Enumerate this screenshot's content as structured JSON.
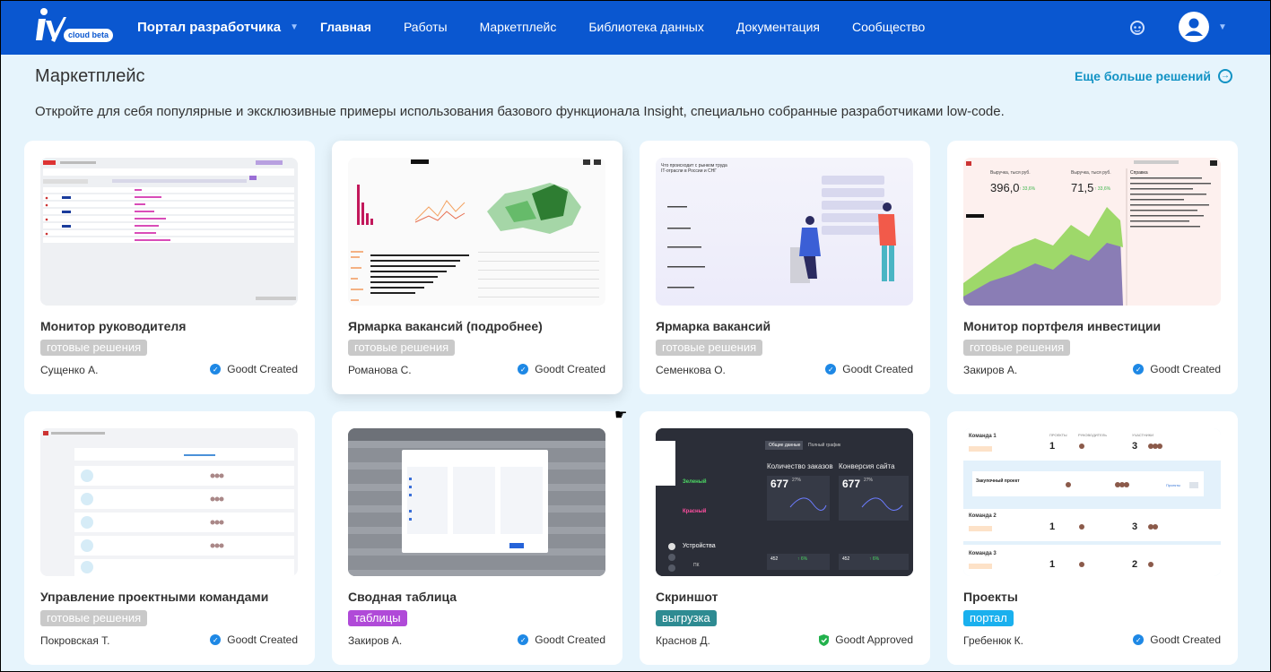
{
  "header": {
    "logo_badge": "cloud beta",
    "portal": "Портал разработчика",
    "nav": [
      "Главная",
      "Работы",
      "Маркетплейс",
      "Библиотека данных",
      "Документация",
      "Сообщество"
    ]
  },
  "page": {
    "title": "Маркетплейс",
    "more_link": "Еще больше решений",
    "subtitle": "Откройте для себя популярные и эксклюзивные примеры использования базового функционала Insight, специально собранные разработчиками low-code."
  },
  "colors": {
    "header": "#0a57d0",
    "tag_ready": "#c9c9c9",
    "tag_tables": "#b04ad8",
    "tag_export": "#2e8b92",
    "tag_portal": "#1ab0ee",
    "check_blue": "#1e88e5",
    "check_green": "#22b14c"
  },
  "cards": [
    {
      "title": "Монитор руководителя",
      "tag": "готовые решения",
      "author": "Сущенко А.",
      "badge": "Goodt Created"
    },
    {
      "title": "Ярмарка вакансий (подробнее)",
      "tag": "готовые решения",
      "author": "Романова С.",
      "badge": "Goodt Created"
    },
    {
      "title": "Ярмарка вакансий",
      "tag": "готовые решения",
      "author": "Семенкова О.",
      "badge": "Goodt Created",
      "thumb_text": [
        "Что происходит с рынком труда",
        "IT-отрасли в России и СНГ"
      ]
    },
    {
      "title": "Монитор портфеля инвестиции",
      "tag": "готовые решения",
      "author": "Закиров А.",
      "badge": "Goodt Created",
      "thumb_text": [
        "Выручка, тыся руб.",
        "396,0",
        "↑ 33,6%",
        "Выручка, тыся руб.",
        "71,5",
        "↑ 33,6%",
        "Справка"
      ]
    },
    {
      "title": "Управление проектными командами",
      "tag": "готовые решения",
      "author": "Покровская Т.",
      "badge": "Goodt Created"
    },
    {
      "title": "Сводная таблица",
      "tag": "таблицы",
      "author": "Закиров А.",
      "badge": "Goodt Created"
    },
    {
      "title": "Скриншот",
      "tag": "выгрузка",
      "author": "Краснов Д.",
      "badge": "Goodt Approved",
      "thumb_text": [
        "Общие данные",
        "Полный график",
        "Количество заказов",
        "Конверсия сайта",
        "677",
        "27%",
        "677",
        "27%",
        "Зеленый",
        "Красный",
        "Устройства",
        "ПК",
        "452",
        "↑ 6%",
        "452",
        "↑ 6%"
      ]
    },
    {
      "title": "Проекты",
      "tag": "портал",
      "author": "Гребенюк К.",
      "badge": "Goodt Created",
      "thumb_text": [
        "Команда 1",
        "ПРОЕКТЫ",
        "РУКОВОДИТЕЛЬ",
        "УЧАСТНИКИ",
        "1",
        "3",
        "Команда 2",
        "1",
        "3",
        "Команда 3",
        "1",
        "2",
        "Закупочный проект",
        "Проекты"
      ]
    }
  ]
}
